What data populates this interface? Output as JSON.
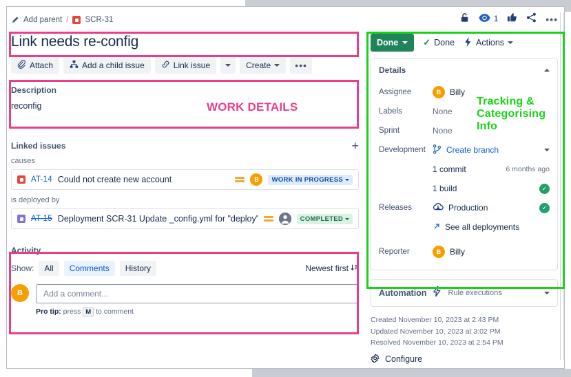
{
  "breadcrumb": {
    "add_parent": "Add parent",
    "separator": "/",
    "issue_key": "SCR-31"
  },
  "issue": {
    "title": "Link needs re-config"
  },
  "toolbar": {
    "attach": "Attach",
    "add_child": "Add a child issue",
    "link_issue": "Link issue",
    "create": "Create",
    "more": "•••"
  },
  "description": {
    "heading": "Description",
    "body": "reconfig"
  },
  "linked_issues": {
    "heading": "Linked issues",
    "add": "+",
    "groups": [
      {
        "relation": "causes",
        "items": [
          {
            "key": "AT-14",
            "summary": "Could not create new account",
            "struck": false,
            "type": "bug",
            "avatar": "B",
            "avatar_grey": false,
            "status": "WORK IN PROGRESS",
            "status_tone": "blue"
          }
        ]
      },
      {
        "relation": "is deployed by",
        "items": [
          {
            "key": "AT-15",
            "summary": "Deployment SCR-31 Update _config.yml for \"deploy\" to ...",
            "struck": true,
            "type": "task",
            "avatar": "",
            "avatar_grey": true,
            "status": "COMPLETED",
            "status_tone": "green"
          }
        ]
      }
    ]
  },
  "activity": {
    "heading": "Activity",
    "show_label": "Show:",
    "filters": [
      {
        "label": "All",
        "active": false
      },
      {
        "label": "Comments",
        "active": true
      },
      {
        "label": "History",
        "active": false
      }
    ],
    "sort": "Newest first",
    "avatar": "B",
    "comment_placeholder": "Add a comment...",
    "protip_prefix": "Pro tip:",
    "protip_mid": " press ",
    "protip_key": "M",
    "protip_suffix": " to comment"
  },
  "header_icons": {
    "watch_count": "1"
  },
  "status": {
    "current": "Done",
    "resolution": "Done",
    "actions": "Actions"
  },
  "details": {
    "heading": "Details",
    "rows": [
      {
        "name": "Assignee",
        "value": "Billy",
        "kind": "user",
        "avatar": "B"
      },
      {
        "name": "Labels",
        "value": "None",
        "kind": "none"
      },
      {
        "name": "Sprint",
        "value": "None",
        "kind": "none"
      },
      {
        "name": "Development",
        "value": "Create branch",
        "kind": "dev-link"
      }
    ],
    "dev_sub": [
      {
        "label": "1 commit",
        "meta": "6 months ago",
        "ok": false
      },
      {
        "label": "1 build",
        "meta": "",
        "ok": true
      }
    ],
    "releases": {
      "name": "Releases",
      "value": "Production",
      "ok": true,
      "see_all": "See all deployments"
    },
    "reporter": {
      "name": "Reporter",
      "value": "Billy",
      "avatar": "B"
    }
  },
  "automation": {
    "title": "Automation",
    "rule_executions": "Rule executions"
  },
  "timestamps": [
    "Created November 10, 2023 at 2:43 PM",
    "Updated November 10, 2023 at 3:02 PM",
    "Resolved November 10, 2023 at 2:54 PM"
  ],
  "configure": "Configure",
  "annotations": {
    "work_details": "WORK DETAILS",
    "tracking": "Tracking &\nCategorising\nInfo",
    "pink": "#e83e8c",
    "green": "#16d316"
  }
}
